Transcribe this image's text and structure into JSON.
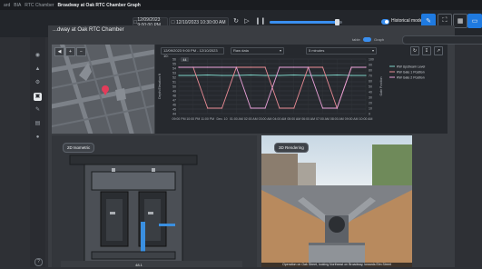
{
  "breadcrumb": {
    "items": [
      "ard",
      "BIA",
      "RTC Chamber"
    ],
    "current": "Broadway at Oak RTC Chamber Graph"
  },
  "toolbar": {
    "start_date": "12/09/2023 9:00:00 PM",
    "end_date": "12/10/2023 10:30:00 AM",
    "playback_progress": 0.92,
    "historical_mode_label": "Historical mode",
    "historical_mode_on": true
  },
  "page": {
    "title": "...dway at Oak RTC Chamber"
  },
  "view_toggle": {
    "table_label": "table",
    "graph_label": "Graph"
  },
  "map": {
    "controls": [
      "◀",
      "+",
      "−"
    ]
  },
  "chart_panel": {
    "date_range": "12/09/2023 9:00 PM - 12/10/2023 10:",
    "dropdown1": "Raw data",
    "dropdown2": "5 minutes"
  },
  "chart_data": {
    "type": "line",
    "title": "",
    "xlabel": "",
    "ylabel_left": "Depth Elevation ft",
    "ylabel_right": "Gate Position",
    "x_ticks": [
      "09:00 PM",
      "10:00 PM",
      "11:00 PM",
      "Dec. 10",
      "01:00 AM",
      "02:00 AM",
      "03:00 AM",
      "04:00 AM",
      "05:00 AM",
      "06:00 AM",
      "07:00 AM",
      "08:00 AM",
      "09:00 AM",
      "10:00 AM"
    ],
    "y_left_ticks": [
      56,
      55,
      54,
      53,
      52,
      51,
      50,
      49,
      48,
      47,
      46,
      45,
      44
    ],
    "y_right_ticks": [
      100,
      90,
      80,
      70,
      60,
      50,
      40,
      30,
      20,
      10,
      0
    ],
    "ylim_left": [
      44,
      56
    ],
    "ylim_right": [
      0,
      100
    ],
    "badge": "44",
    "legend_position": "right",
    "series": [
      {
        "name": "RW Upstream Level",
        "color": "#7fd4c8",
        "axis": "left",
        "values": [
          52.4,
          52.4,
          52.5,
          52.4,
          52.4,
          52.5,
          52.4,
          52.4,
          52.5,
          52.4,
          52.4,
          52.5,
          52.4,
          52.4
        ]
      },
      {
        "name": "RW Gate 1 Position",
        "color": "#e88a94",
        "axis": "right",
        "values": [
          85,
          85,
          10,
          10,
          85,
          85,
          85,
          10,
          10,
          85,
          85,
          10,
          85,
          85
        ]
      },
      {
        "name": "RW Gate 2 Position",
        "color": "#e8a0d8",
        "axis": "right",
        "values": [
          85,
          85,
          85,
          85,
          85,
          10,
          10,
          85,
          85,
          85,
          10,
          10,
          85,
          85
        ]
      }
    ]
  },
  "lower_left": {
    "label": "2D Isometric",
    "bottom_label": "48.1"
  },
  "lower_right": {
    "label": "3D Rendering",
    "caption": "Operation on Oak Street, looking Northeast on Broadway, towards Elm Street"
  }
}
